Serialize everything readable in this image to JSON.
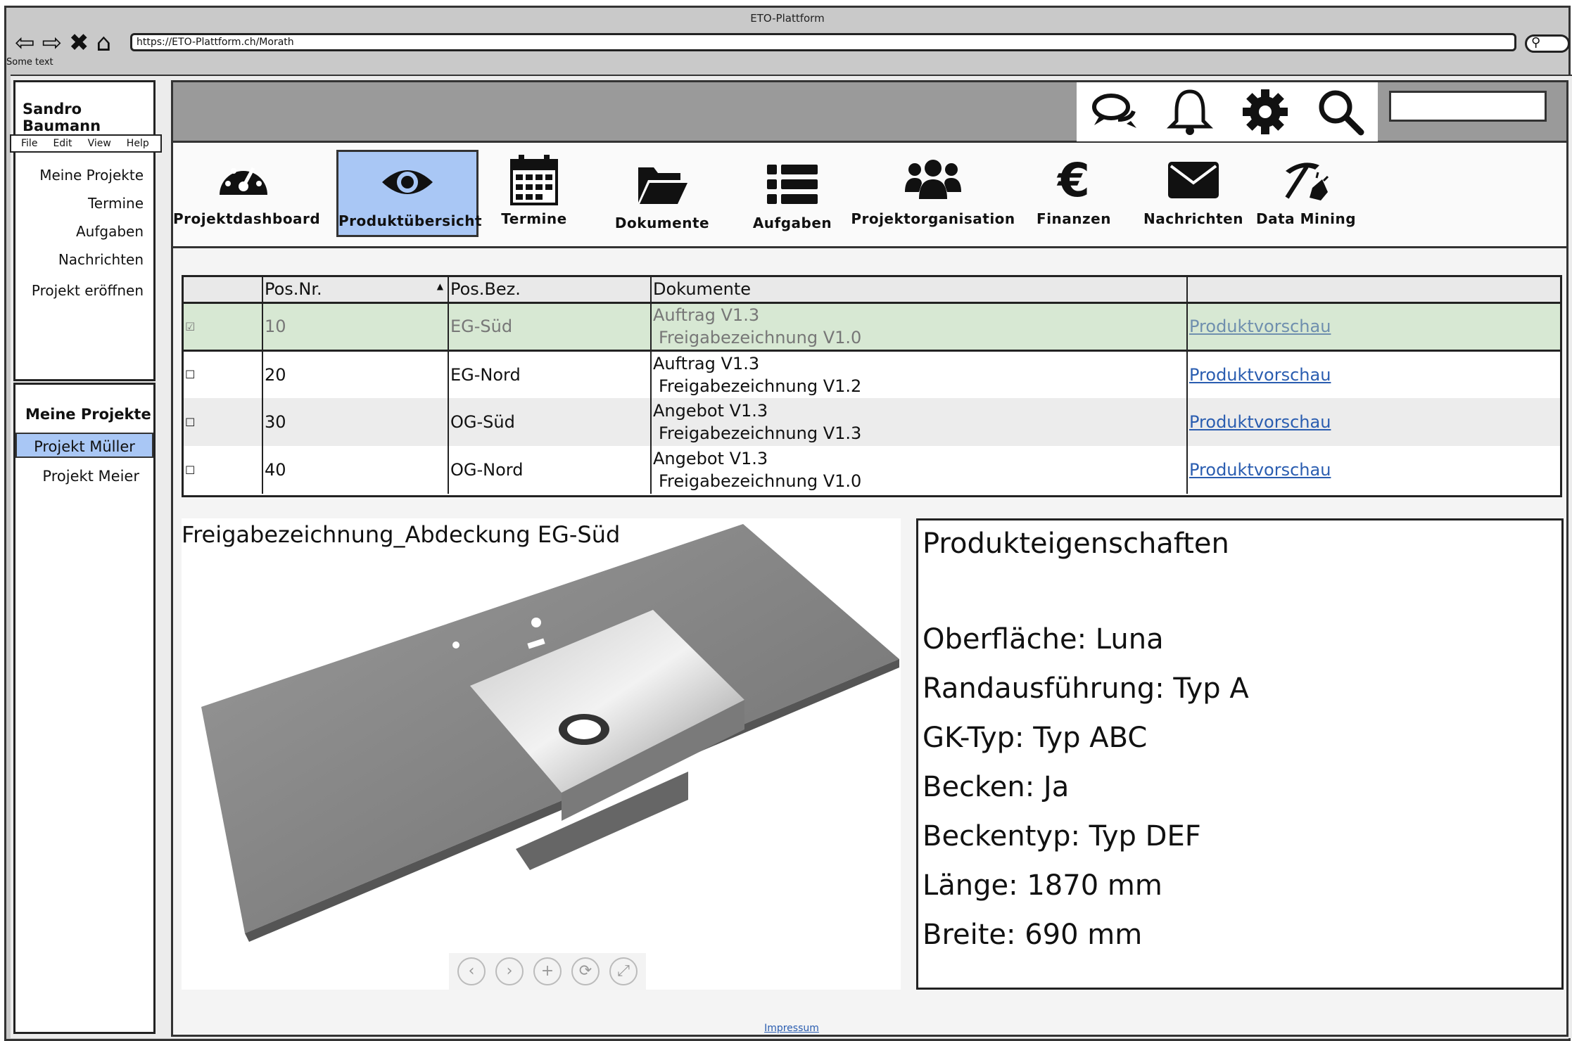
{
  "window": {
    "title": "ETO-Plattform",
    "url": "https://ETO-Plattform.ch/Morath",
    "some_text": "Some text"
  },
  "nav_icons": [
    "back-icon",
    "forward-icon",
    "close-icon",
    "home-icon"
  ],
  "user": {
    "name": "Sandro Baumann"
  },
  "menubar": [
    "File",
    "Edit",
    "View",
    "Help"
  ],
  "side_nav": [
    "Meine Projekte",
    "Termine",
    "Aufgaben",
    "Nachrichten",
    "Projekt eröffnen"
  ],
  "projects": {
    "heading": "Meine Projekte",
    "items": [
      "Projekt Müller",
      "Projekt Meier"
    ],
    "active": "Projekt Müller"
  },
  "toolbar": [
    "chat-icon",
    "bell-icon",
    "gear-icon",
    "search-icon"
  ],
  "tabs": [
    {
      "label": "Projektdashboard",
      "icon": "dashboard-icon"
    },
    {
      "label": "Produktübersicht",
      "icon": "eye-icon",
      "active": true
    },
    {
      "label": "Termine",
      "icon": "calendar-icon"
    },
    {
      "label": "Dokumente",
      "icon": "folder-icon"
    },
    {
      "label": "Aufgaben",
      "icon": "list-icon"
    },
    {
      "label": "Projektorganisation",
      "icon": "users-icon"
    },
    {
      "label": "Finanzen",
      "icon": "euro-icon"
    },
    {
      "label": "Nachrichten",
      "icon": "envelope-icon"
    },
    {
      "label": "Data Mining",
      "icon": "pickaxe-icon"
    }
  ],
  "table": {
    "headers": [
      "",
      "Pos.Nr.",
      "Pos.Bez.",
      "Dokumente",
      ""
    ],
    "rows": [
      {
        "checked": "☑",
        "pos": "10",
        "bez": "EG-Süd",
        "doc1": "Auftrag V1.3",
        "doc2": "Freigabezeichnung V1.0",
        "link": "Produktvorschau",
        "selected": true
      },
      {
        "checked": "☐",
        "pos": "20",
        "bez": "EG-Nord",
        "doc1": "Auftrag V1.3",
        "doc2": "Freigabezeichnung V1.2",
        "link": "Produktvorschau"
      },
      {
        "checked": "☐",
        "pos": "30",
        "bez": "OG-Süd",
        "doc1": "Angebot V1.3",
        "doc2": "Freigabezeichnung V1.3",
        "link": "Produktvorschau"
      },
      {
        "checked": "☐",
        "pos": "40",
        "bez": "OG-Nord",
        "doc1": "Angebot V1.3",
        "doc2": "Freigabezeichnung V1.0",
        "link": "Produktvorschau"
      }
    ]
  },
  "preview": {
    "title": "Freigabezeichnung_Abdeckung EG-Süd",
    "controls": [
      "‹",
      "›",
      "+",
      "⟳",
      "⤢"
    ]
  },
  "properties": {
    "title": "Produkteigenschaften",
    "items": [
      "Oberfläche: Luna",
      "Randausführung: Typ A",
      "GK-Typ: Typ ABC",
      "Becken: Ja",
      "Beckentyp: Typ DEF",
      "Länge: 1870 mm",
      "Breite: 690 mm"
    ]
  },
  "footer": {
    "link": "Impressum"
  }
}
